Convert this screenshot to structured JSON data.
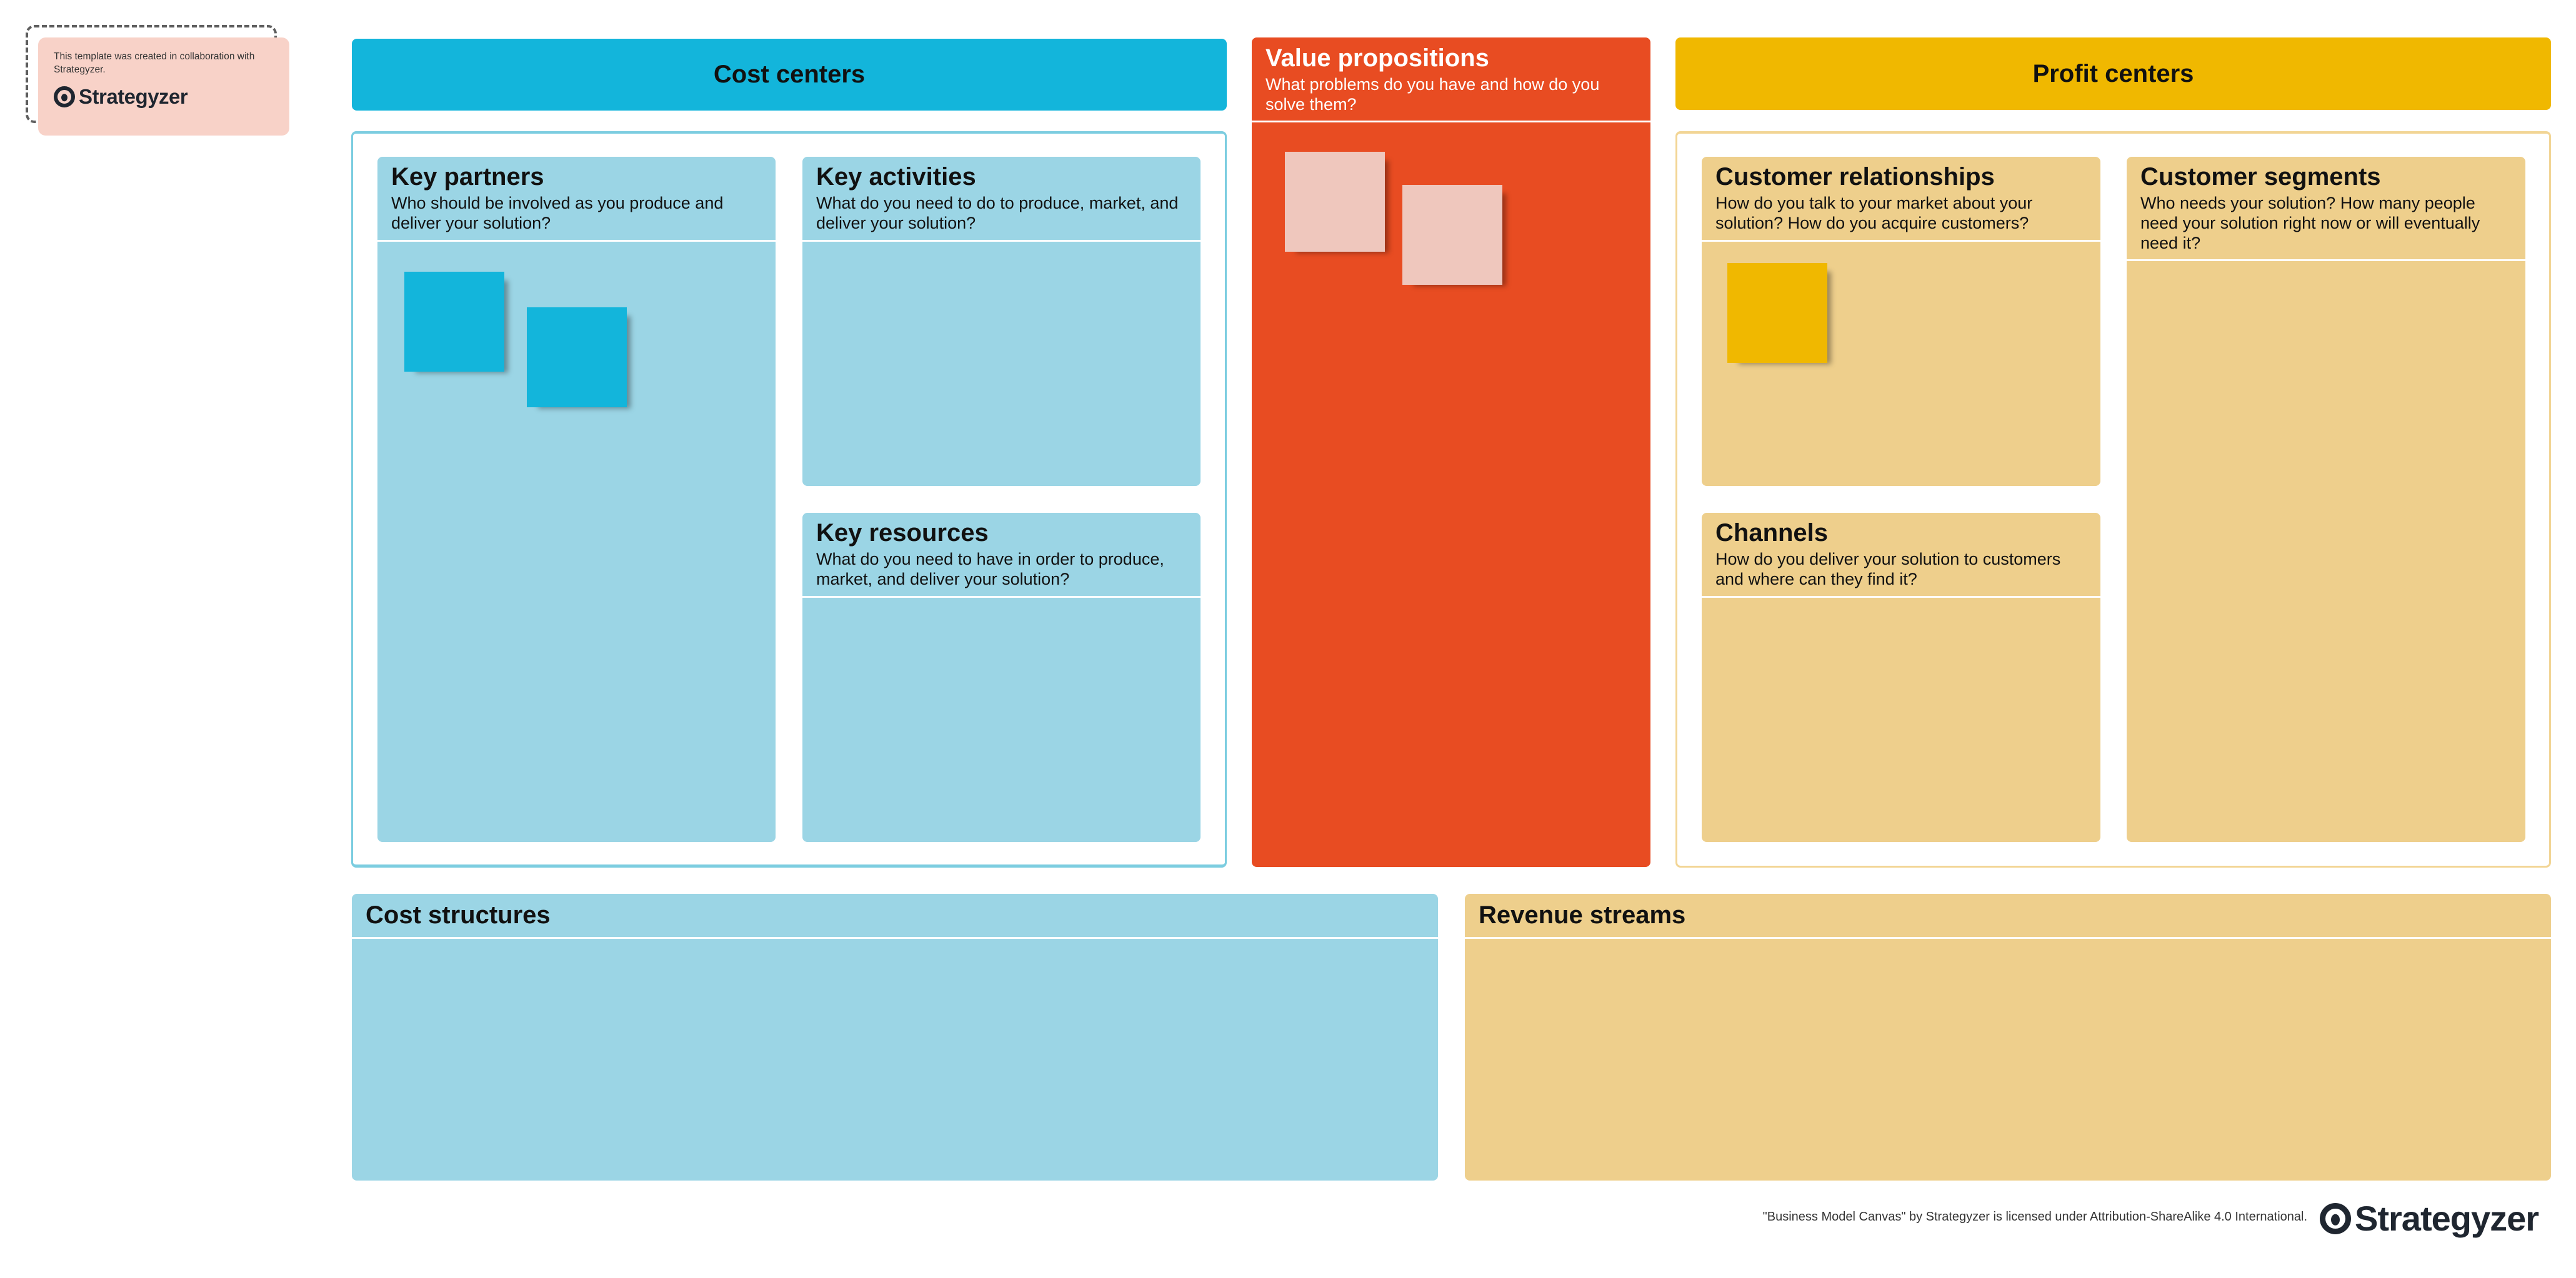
{
  "attribution_note": {
    "text": "This template was created in collaboration with Strategyzer.",
    "logo_text": "Strategyzer",
    "logo_icon": "strategyzer-mark-icon"
  },
  "headers": {
    "cost_centers": "Cost centers",
    "profit_centers": "Profit centers"
  },
  "blocks": {
    "key_partners": {
      "title": "Key partners",
      "subtitle": "Who should be involved as you produce and deliver your solution?"
    },
    "key_activities": {
      "title": "Key activities",
      "subtitle": "What do you need to do to produce, market, and deliver your solution?"
    },
    "key_resources": {
      "title": "Key resources",
      "subtitle": "What do you need to have in order to produce, market, and deliver your solution?"
    },
    "value_propositions": {
      "title": "Value propositions",
      "subtitle": "What problems do you have and how do you solve them?"
    },
    "customer_relationships": {
      "title": "Customer relationships",
      "subtitle": "How do you talk to your market about your solution? How do you acquire customers?"
    },
    "channels": {
      "title": "Channels",
      "subtitle": "How do you deliver your solution to customers and where can they find it?"
    },
    "customer_segments": {
      "title": "Customer segments",
      "subtitle": "Who needs your solution? How many people need your solution right now or will eventually need it?"
    },
    "cost_structures": {
      "title": "Cost structures"
    },
    "revenue_streams": {
      "title": "Revenue streams"
    }
  },
  "sticky_notes": {
    "key_partners": [
      "",
      ""
    ],
    "value_propositions": [
      "",
      ""
    ],
    "customer_relationships": [
      ""
    ]
  },
  "colors": {
    "cost_accent": "#13b5db",
    "cost_block": "#9bd5e5",
    "value_accent": "#e84c22",
    "value_sticky": "#efc7bd",
    "profit_accent": "#f0b800",
    "profit_block": "#eecf8c",
    "note_background": "#f8d2c8"
  },
  "footer": {
    "license": "\"Business Model Canvas\" by Strategyzer is licensed under Attribution-ShareAlike 4.0 International.",
    "logo_text": "Strategyzer"
  }
}
